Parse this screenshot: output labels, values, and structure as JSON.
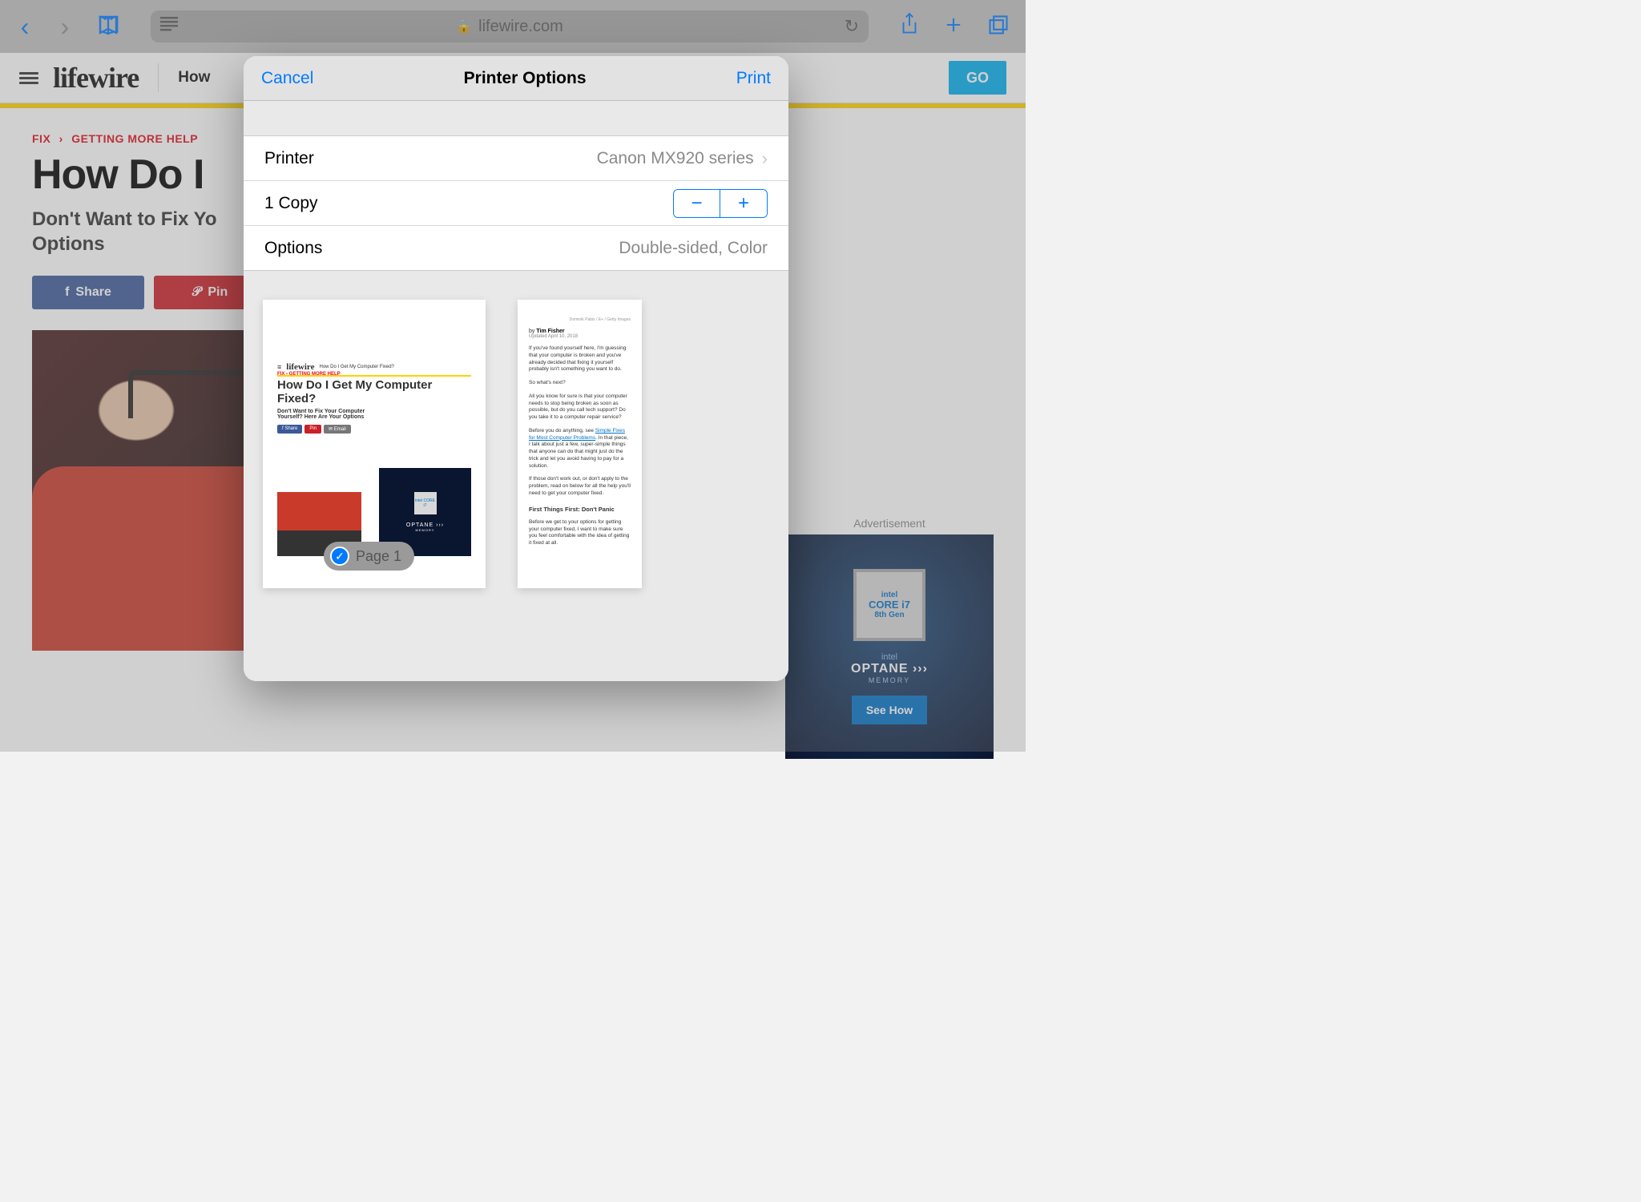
{
  "safari": {
    "url_host": "lifewire.com"
  },
  "header": {
    "logo": "lifewire",
    "nav_item": "How",
    "go_label": "GO"
  },
  "breadcrumb": {
    "level1": "FIX",
    "level2": "GETTING MORE HELP"
  },
  "article": {
    "title_visible": "How Do I                                       d?",
    "subtitle_visible": "Don't Want to Fix Yo\nOptions",
    "full_title": "How Do I Get My Computer Fixed?",
    "full_subtitle": "Don't Want to Fix Your Computer Yourself? Here Are Your Options"
  },
  "share": {
    "facebook": "Share",
    "pinterest": "Pin"
  },
  "ad": {
    "label": "Advertisement",
    "chip_brand": "intel",
    "chip_line1": "CORE i7",
    "chip_line2": "8th Gen",
    "optane_brand": "intel",
    "optane_text": "OPTANE ›››",
    "optane_sub": "MEMORY",
    "cta": "See How"
  },
  "modal": {
    "cancel": "Cancel",
    "title": "Printer Options",
    "print": "Print",
    "rows": {
      "printer_label": "Printer",
      "printer_value": "Canon MX920 series",
      "copies_label": "1 Copy",
      "options_label": "Options",
      "options_value": "Double-sided, Color"
    },
    "page_badge": "Page 1"
  },
  "preview_page1": {
    "mini_logo": "lifewire",
    "mini_nav": "How Do I Get My Computer Fixed?",
    "mini_bc": "FIX  ›  GETTING MORE HELP",
    "mini_h1": "How Do I Get My Computer Fixed?",
    "mini_sub": "Don't Want to Fix Your Computer Yourself? Here Are Your Options",
    "share_fb": "f Share",
    "share_pin": "Pin",
    "share_email": "✉ Email",
    "ad_chip": "intel CORE i7",
    "ad_optane": "OPTANE ›››"
  },
  "preview_page2": {
    "credit": "Dominik Pabis / E+ / Getty Images",
    "author_prefix": "by",
    "author": "Tim Fisher",
    "date": "Updated April 10, 2018",
    "para1": "If you've found yourself here, I'm guessing that your computer is broken and you've already decided that fixing it yourself probably isn't something you want to do.",
    "para2": "So what's next?",
    "para3": "All you know for sure is that your computer needs to stop being broken as soon as possible, but do you call tech support? Do you take it to a computer repair service?",
    "para4_a": "Before you do anything, see ",
    "para4_link": "Simple Fixes for Most Computer Problems",
    "para4_b": ". In that piece, I talk about just a few, super-simple things that anyone can do that might just do the trick and let you avoid having to pay for a solution.",
    "para5": "If those don't work out, or don't apply to the problem, read on below for all the help you'll need to get your computer fixed.",
    "heading": "First Things First: Don't Panic",
    "para6": "Before we get to your options for getting your computer fixed, I want to make sure you feel comfortable with the idea of getting it fixed at all."
  }
}
